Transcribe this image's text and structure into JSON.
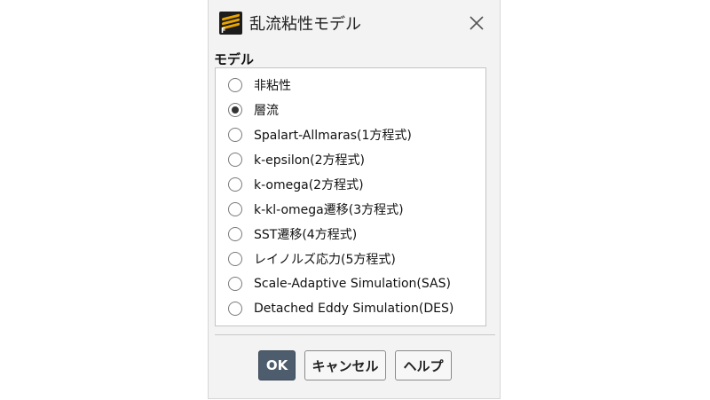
{
  "window": {
    "title": "乱流粘性モデル",
    "icon": "fluent-app-icon",
    "icon_letter": "F",
    "close_icon": "close-icon"
  },
  "model_group": {
    "label": "モデル",
    "options": [
      {
        "label": "非粘性",
        "checked": false
      },
      {
        "label": "層流",
        "checked": true
      },
      {
        "label": "Spalart-Allmaras(1方程式)",
        "checked": false
      },
      {
        "label": "k-epsilon(2方程式)",
        "checked": false
      },
      {
        "label": "k-omega(2方程式)",
        "checked": false
      },
      {
        "label": "k-kl-omega遷移(3方程式)",
        "checked": false
      },
      {
        "label": "SST遷移(4方程式)",
        "checked": false
      },
      {
        "label": "レイノルズ応力(5方程式)",
        "checked": false
      },
      {
        "label": "Scale-Adaptive Simulation(SAS)",
        "checked": false
      },
      {
        "label": "Detached Eddy Simulation(DES)",
        "checked": false
      }
    ]
  },
  "buttons": {
    "ok": "OK",
    "cancel": "キャンセル",
    "help": "ヘルプ"
  },
  "colors": {
    "primary_button": "#4e5d6d",
    "dialog_background": "#f3f3f3"
  }
}
